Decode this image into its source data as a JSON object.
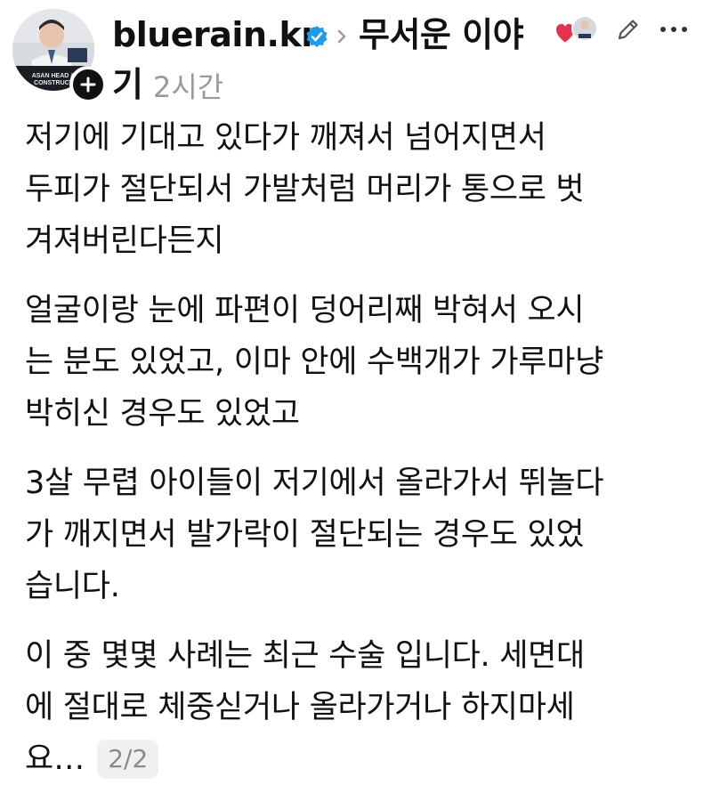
{
  "post": {
    "username": "bluerain.kr",
    "topic_line1": "무서운 이야",
    "topic_line2": "기",
    "time_ago": "2시간",
    "avatar_caption_1": "ASAN HEAD &",
    "avatar_caption_2": "CONSTRUCT",
    "paragraphs": [
      "저기에 기대고 있다가 깨져서 넘어지면서\n두피가 절단되서 가발처럼 머리가 통으로 벗\n겨져버린다든지",
      "얼굴이랑 눈에 파편이 덩어리째 박혀서 오시\n는 분도 있었고, 이마 안에 수백개가 가루마냥\n박히신 경우도 있었고",
      "3살 무렵 아이들이 저기에서 올라가서 뛰놀다\n가 깨지면서 발가락이 절단되는 경우도 있었\n습니다.",
      "이 중 몇몇 사례는 최근 수술 입니다. 세면대\n에 절대로 체중싣거나 올라가거나 하지마세"
    ],
    "last_line": "요…",
    "page_count": "2/2"
  },
  "icons": {
    "verified": "verified-badge-icon",
    "chevron": "chevron-right-icon",
    "reaction": "heart-reaction-icon",
    "edit": "pencil-icon",
    "more": "more-horizontal-icon",
    "follow": "plus-icon"
  },
  "colors": {
    "verified_blue": "#1d9bf0",
    "text": "#111111",
    "muted": "#9a9a9a",
    "heart": "#e8304f",
    "badge_bg": "#f0f0f0"
  }
}
